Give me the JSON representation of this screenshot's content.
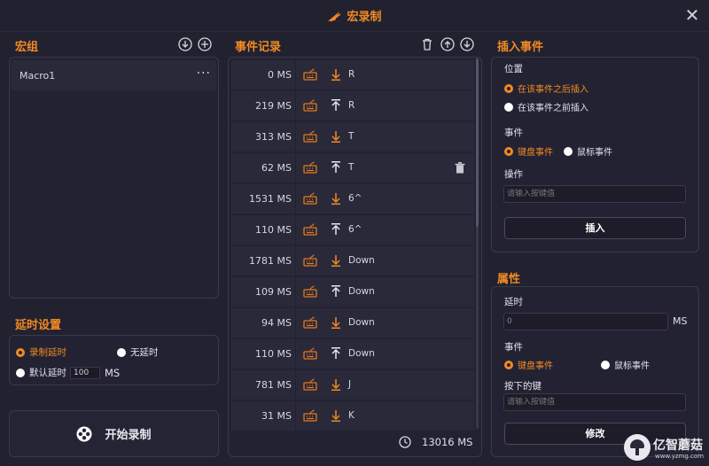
{
  "window": {
    "title": "宏录制"
  },
  "macro_group": {
    "title": "宏组",
    "items": [
      {
        "name": "Macro1",
        "more": "···"
      }
    ]
  },
  "delay_settings": {
    "title": "延时设置",
    "options": {
      "record": "录制延时",
      "none": "无延时",
      "default": "默认延时"
    },
    "selected": "record",
    "default_value": "100",
    "unit": "MS"
  },
  "start_button": {
    "label": "开始录制"
  },
  "events": {
    "title": "事件记录",
    "rows": [
      {
        "delay": "0 MS",
        "direction": "down",
        "key": "R"
      },
      {
        "delay": "219 MS",
        "direction": "up",
        "key": "R"
      },
      {
        "delay": "313 MS",
        "direction": "down",
        "key": "T"
      },
      {
        "delay": "62 MS",
        "direction": "up",
        "key": "T"
      },
      {
        "delay": "1531 MS",
        "direction": "down",
        "key": "6^"
      },
      {
        "delay": "110 MS",
        "direction": "up",
        "key": "6^"
      },
      {
        "delay": "1781 MS",
        "direction": "down",
        "key": "Down"
      },
      {
        "delay": "109 MS",
        "direction": "up",
        "key": "Down"
      },
      {
        "delay": "94 MS",
        "direction": "down",
        "key": "Down"
      },
      {
        "delay": "110 MS",
        "direction": "up",
        "key": "Down"
      },
      {
        "delay": "781 MS",
        "direction": "down",
        "key": "J"
      },
      {
        "delay": "31 MS",
        "direction": "down",
        "key": "K"
      }
    ],
    "hovered_row": 3,
    "total": "13016 MS"
  },
  "insert_event": {
    "title": "插入事件",
    "position_label": "位置",
    "position_options": {
      "after": "在该事件之后插入",
      "before": "在该事件之前插入"
    },
    "position_selected": "after",
    "event_label": "事件",
    "event_options": {
      "keyboard": "键盘事件",
      "mouse": "鼠标事件"
    },
    "event_selected": "keyboard",
    "action_label": "操作",
    "action_placeholder": "请输入按键值",
    "button": "插入"
  },
  "properties": {
    "title": "属性",
    "delay_label": "延时",
    "delay_value": "0",
    "delay_unit": "MS",
    "event_label": "事件",
    "event_options": {
      "keyboard": "键盘事件",
      "mouse": "鼠标事件"
    },
    "event_selected": "keyboard",
    "key_label": "按下的键",
    "key_placeholder": "请输入按键值",
    "button": "修改"
  },
  "watermark": {
    "brand": "亿智蘑菇",
    "url": "www.yzmg.com"
  },
  "colors": {
    "accent": "#f08a24",
    "background": "#22212f",
    "panel_border": "#3a394c",
    "row": "#2a2939"
  }
}
